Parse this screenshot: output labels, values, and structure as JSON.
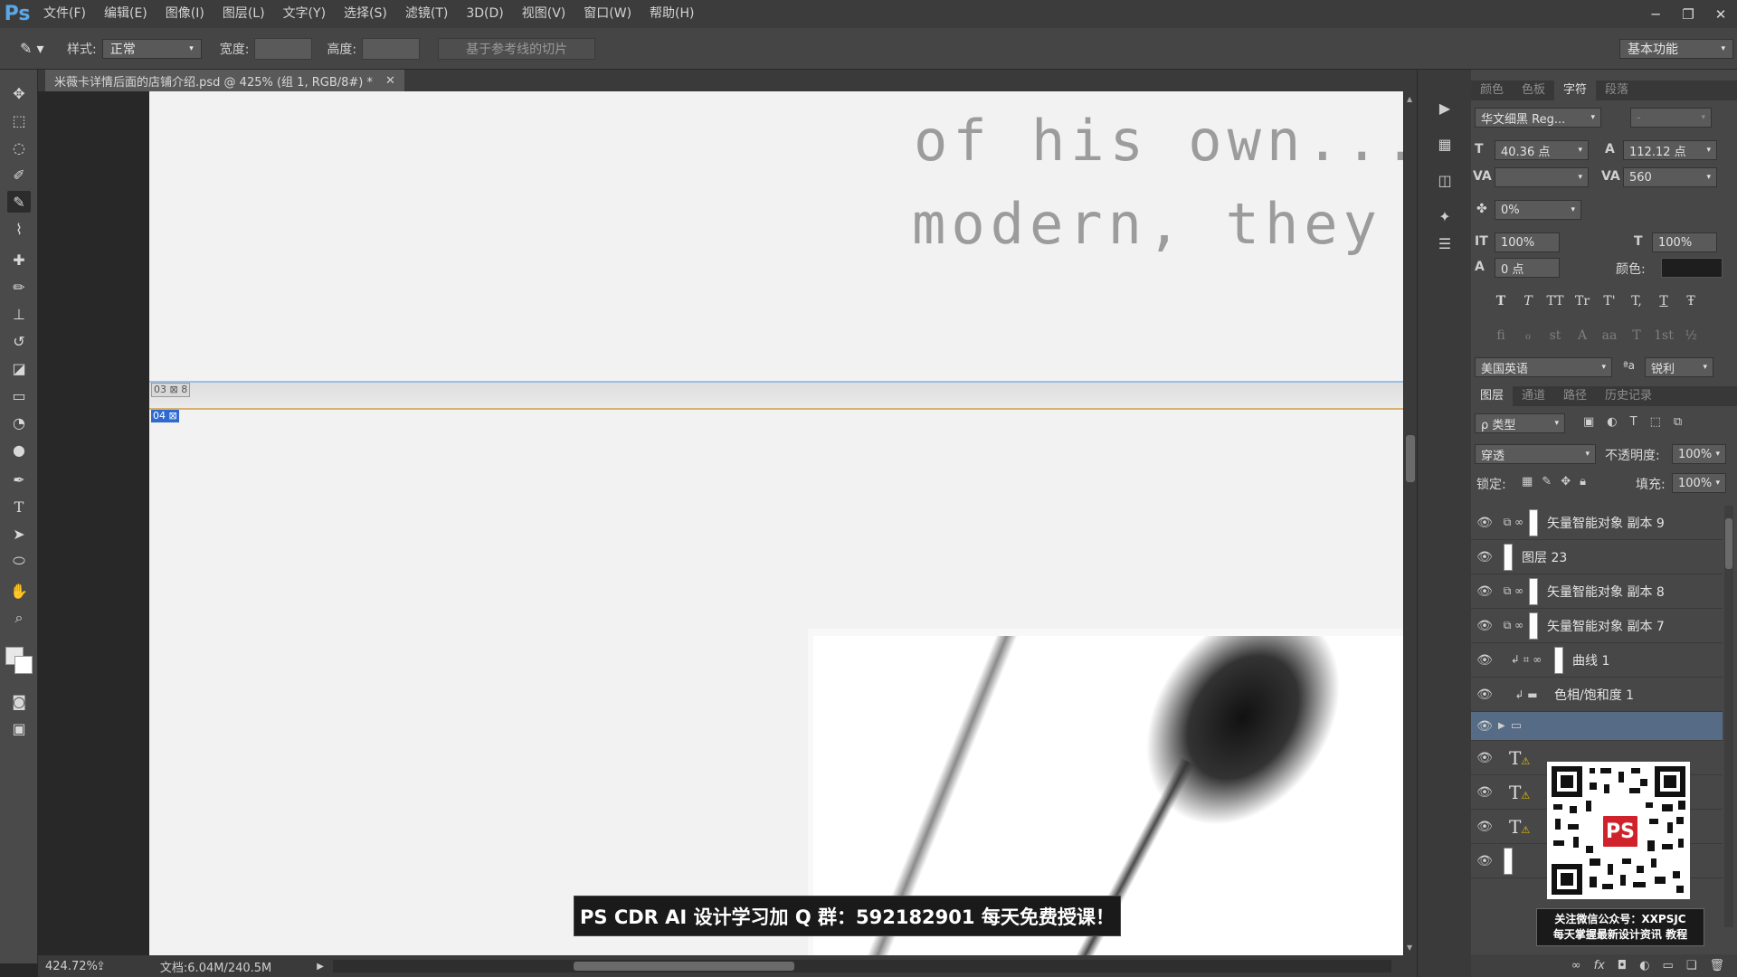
{
  "app": {
    "logo": "Ps"
  },
  "menu": [
    "文件(F)",
    "编辑(E)",
    "图像(I)",
    "图层(L)",
    "文字(Y)",
    "选择(S)",
    "滤镜(T)",
    "3D(D)",
    "视图(V)",
    "窗口(W)",
    "帮助(H)"
  ],
  "window_controls": {
    "minimize": "─",
    "restore": "❐",
    "close": "✕"
  },
  "options": {
    "style_label": "样式:",
    "style_value": "正常",
    "width_label": "宽度:",
    "height_label": "高度:",
    "slices_button": "基于参考线的切片",
    "workspace": "基本功能"
  },
  "document": {
    "tab_title": "米薇卡详情后面的店铺介绍.psd @ 425% (组 1, RGB/8#) *",
    "text_line_1": "of his own...",
    "text_line_2": "modern, they",
    "slice_03": "03 ⊠ 8",
    "slice_04": "04 ⊠"
  },
  "watermark": "PS CDR AI 设计学习加 Q 群：592182901 每天免费授课！",
  "status": {
    "zoom": "424.72%",
    "doc_info": "文档:6.04M/240.5M"
  },
  "character_panel": {
    "tabs": [
      "颜色",
      "色板",
      "字符",
      "段落"
    ],
    "active_tab": 2,
    "font_family": "华文细黑 Reg...",
    "font_style": "-",
    "font_size": "40.36 点",
    "leading": "112.12 点",
    "kerning": "",
    "tracking": "560",
    "scale_pct": "0%",
    "vscale": "100%",
    "hscale": "100%",
    "baseline": "0 点",
    "color_label": "颜色:",
    "color_value": "#1e1e1e",
    "format_buttons": [
      "T",
      "T",
      "TT",
      "Tr",
      "T'",
      "T,",
      "T",
      "Ŧ"
    ],
    "opentype_buttons": [
      "fi",
      "ℴ",
      "st",
      "A",
      "aa",
      "T",
      "1st",
      "½"
    ],
    "language": "美国英语",
    "aa_label": "ªa",
    "antialias": "锐利"
  },
  "layers_panel": {
    "tabs": [
      "图层",
      "通道",
      "路径",
      "历史记录"
    ],
    "active_tab": 0,
    "filter_kind": "ρ 类型",
    "blend_mode": "穿透",
    "opacity_label": "不透明度:",
    "opacity": "100%",
    "lock_label": "锁定:",
    "fill_label": "填充:",
    "fill": "100%",
    "layers": [
      {
        "name": "矢量智能对象 副本 9",
        "kind": "smart"
      },
      {
        "name": "图层 23",
        "kind": "pixel"
      },
      {
        "name": "矢量智能对象 副本 8",
        "kind": "smart"
      },
      {
        "name": "矢量智能对象 副本 7",
        "kind": "smart"
      },
      {
        "name": "曲线 1",
        "kind": "adjust"
      },
      {
        "name": "色相/饱和度 1",
        "kind": "adjust"
      },
      {
        "name": "",
        "kind": "group"
      },
      {
        "name": "",
        "kind": "text"
      },
      {
        "name": "",
        "kind": "text"
      },
      {
        "name": "",
        "kind": "text"
      },
      {
        "name": "",
        "kind": "pixel"
      }
    ]
  },
  "qr": {
    "badge": "PS",
    "caption_1": "关注微信公众号：XXPSJC",
    "caption_2": "每天掌握最新设计资讯 教程"
  }
}
